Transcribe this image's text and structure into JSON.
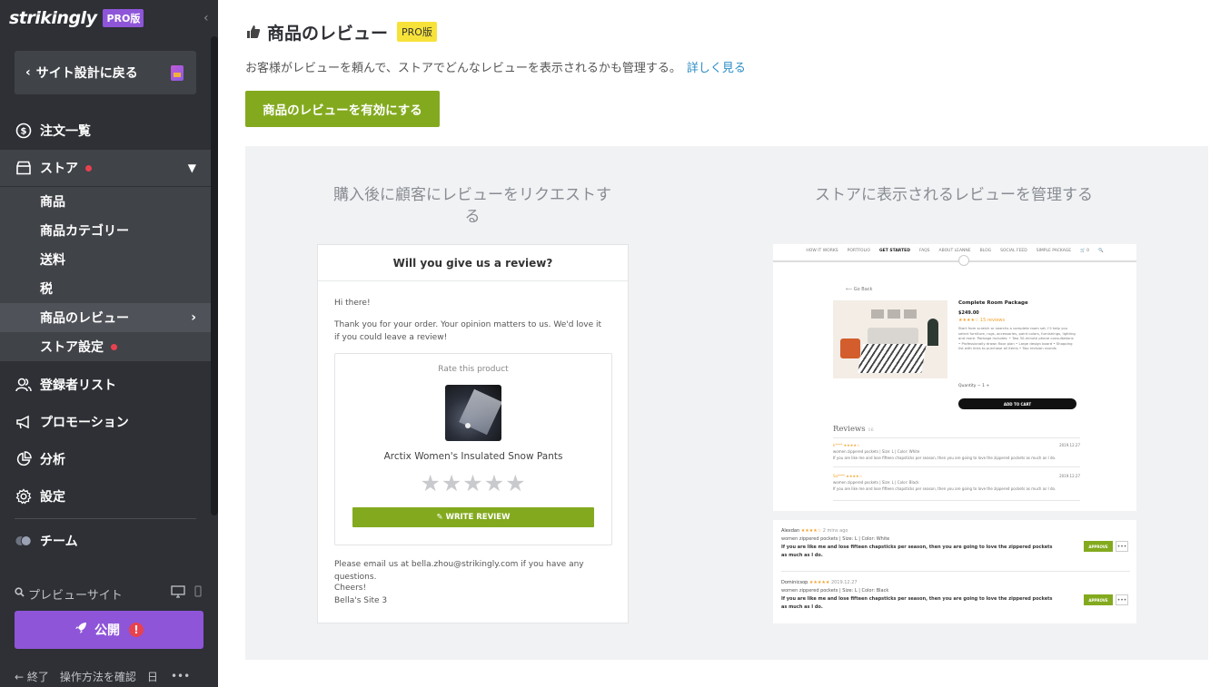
{
  "sidebar": {
    "brand": "strikingly",
    "pro_badge": "PRO版",
    "back_label": "サイト設計に戻る",
    "nav": {
      "orders": "注文一覧",
      "store": "ストア",
      "subscribers": "登録者リスト",
      "promotion": "プロモーション",
      "analytics": "分析",
      "settings": "設定",
      "team": "チーム"
    },
    "store_sub": [
      "商品",
      "商品カテゴリー",
      "送料",
      "税",
      "商品のレビュー",
      "ストア設定"
    ],
    "preview": "プレビューサイト",
    "publish": "公開",
    "bottom": {
      "exit": "終了",
      "help": "操作方法を確認",
      "lang": "日",
      "more": "•••"
    }
  },
  "main": {
    "title": "商品のレビュー",
    "pro_badge": "PRO版",
    "description": "お客様がレビューを頼んで、ストアでどんなレビューを表示されるかも管理する。",
    "learn_more": "詳しく見る",
    "enable_button": "商品のレビューを有効にする",
    "col_left_title": "購入後に顧客にレビューをリクエストする",
    "col_right_title": "ストアに表示されるレビューを管理する"
  },
  "email": {
    "header": "Will you give us a review?",
    "greeting": "Hi there!",
    "body": "Thank you for your order. Your opinion matters to us. We'd love it if you could leave a review!",
    "rate_label": "Rate this product",
    "product_name": "Arctix Women's Insulated Snow Pants",
    "stars": "★★★★★",
    "write_review": "✎  WRITE REVIEW",
    "contact": "Please email us at bella.zhou@strikingly.com if you have any questions.",
    "cheers": "Cheers!",
    "signature": "Bella's Site 3"
  },
  "store": {
    "nav_items": [
      "HOW IT WORKS",
      "PORTFOLIO",
      "GET STARTED",
      "FAQS",
      "ABOUT LEANNE",
      "BLOG",
      "SOCIAL FEED",
      "SIMPLE PACKAGE",
      "🛒 0",
      "🔍"
    ],
    "back": "⟵ Go Back",
    "product_title": "Complete Room Package",
    "price": "$249.00",
    "stars": "★★★★☆ 15 reviews",
    "desc": "Start from scratch or searchs a complete room set. I'll help you select furniture, rugs, accessories, paint colors, furnishings, lighting and more. Package includes: • Two 30-minute phone consultations • Professionally drawn floor plan • Large design board • Shopping list with links to purchase all items • Two revision rounds",
    "qty": "Quantity          −   1   +",
    "add_to_cart": "ADD TO CART",
    "reviews_title": "Reviews",
    "reviews_count": "16",
    "reviews": [
      {
        "stars": "k**** ★★★★☆",
        "meta": "women zippered pockets  |  Size: L  |  Color: White",
        "text": "If you are like me and lose fifteen chapsticks per season, then you are going to love the zippered pockets as much as I do.",
        "date": "2019.12.27"
      },
      {
        "stars": "Sa**** ★★★★☆",
        "meta": "women zippered pockets  |  Size: L  |  Color: Black",
        "text": "If you are like me and lose fifteen chapsticks per season, then you are going to love the zippered pockets as much as I do.",
        "date": "2019.12.27"
      }
    ]
  },
  "approve_list": [
    {
      "name": "Alexdan",
      "stars": "★★★★☆",
      "time": "2 mins ago",
      "meta": "women zippered pockets  |  Size: L  |  Color: White",
      "text": "If you are like me and lose fifteen chapsticks per season, then you are going to love the zippered pockets as much as I do.",
      "button": "APPROVE",
      "more": "•••"
    },
    {
      "name": "Dominicsop",
      "stars": "★★★★★",
      "time": "2019.12.27",
      "meta": "women zippered pockets  |  Size: L  |  Color: Black",
      "text": "If you are like me and lose fifteen chapsticks per season, then you are going to love the zippered pockets as much as I do.",
      "button": "APPROVE",
      "more": "•••"
    }
  ],
  "colors": {
    "sidebar_bg": "#2e3035",
    "brand_purple": "#8e55d9",
    "green": "#83aa1e",
    "red_dot": "#e8414f",
    "link": "#2d8ec5",
    "pro_yellow": "#f7e23a"
  }
}
